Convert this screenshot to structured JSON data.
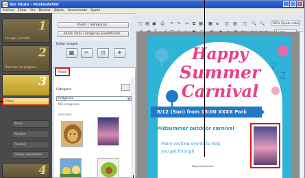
{
  "window": {
    "title": "Sin título - PosterArtist",
    "controls": [
      "_",
      "□",
      "×"
    ]
  },
  "menu": [
    "Archivo",
    "Editar",
    "Ver",
    "Diseñar",
    "Objeto",
    "Herramienta",
    "Ayuda"
  ],
  "steps": [
    {
      "num": "1",
      "label": "Escoger plantilla"
    },
    {
      "num": "2",
      "label": "Distintos de páginas"
    },
    {
      "num": "3",
      "label": ""
    },
    {
      "num": "4",
      "label": ""
    }
  ],
  "step3_items": [
    "Fotos",
    "Texto",
    "Fondos",
    "Fondos",
    "Dibujo variedades"
  ],
  "left_buttons": {
    "add_template": "Añadir / reemplazar...",
    "add_photos": "Añadir fotos / imágenes predefinidas..."
  },
  "edit_image_label": "Editar imagen",
  "edit_icons": [
    "▦",
    "✂",
    "⊡",
    "☀"
  ],
  "gallery": {
    "tab": "Fotos",
    "tab_arrow": "▸",
    "category_label": "Categoría",
    "category_value": "Imágenes",
    "select_value": "Mis imágenes",
    "section_label": "Adorado:"
  },
  "toolbar": {
    "zoom": "100% (Ajuste vista)",
    "edge_label": "Mar.: edición diseño",
    "edge_value": "Ajustes"
  },
  "poster": {
    "line1": "Happy",
    "line2": "Summer",
    "line3": "Carnival",
    "banner": "8/12 (Sun) from 13:00  XXXX Park",
    "subtitle": "Midsummer outdoor carnival",
    "text1": "Many exciting events to help",
    "text2": "you get through",
    "url": "http://xxxxxx.com"
  },
  "colors": {
    "accent": "#e01010",
    "poster_bg": "#2fb3d6",
    "title_pink": "#ec3f86",
    "banner_blue": "#2278c7",
    "step_gold": "#e2c74f"
  }
}
